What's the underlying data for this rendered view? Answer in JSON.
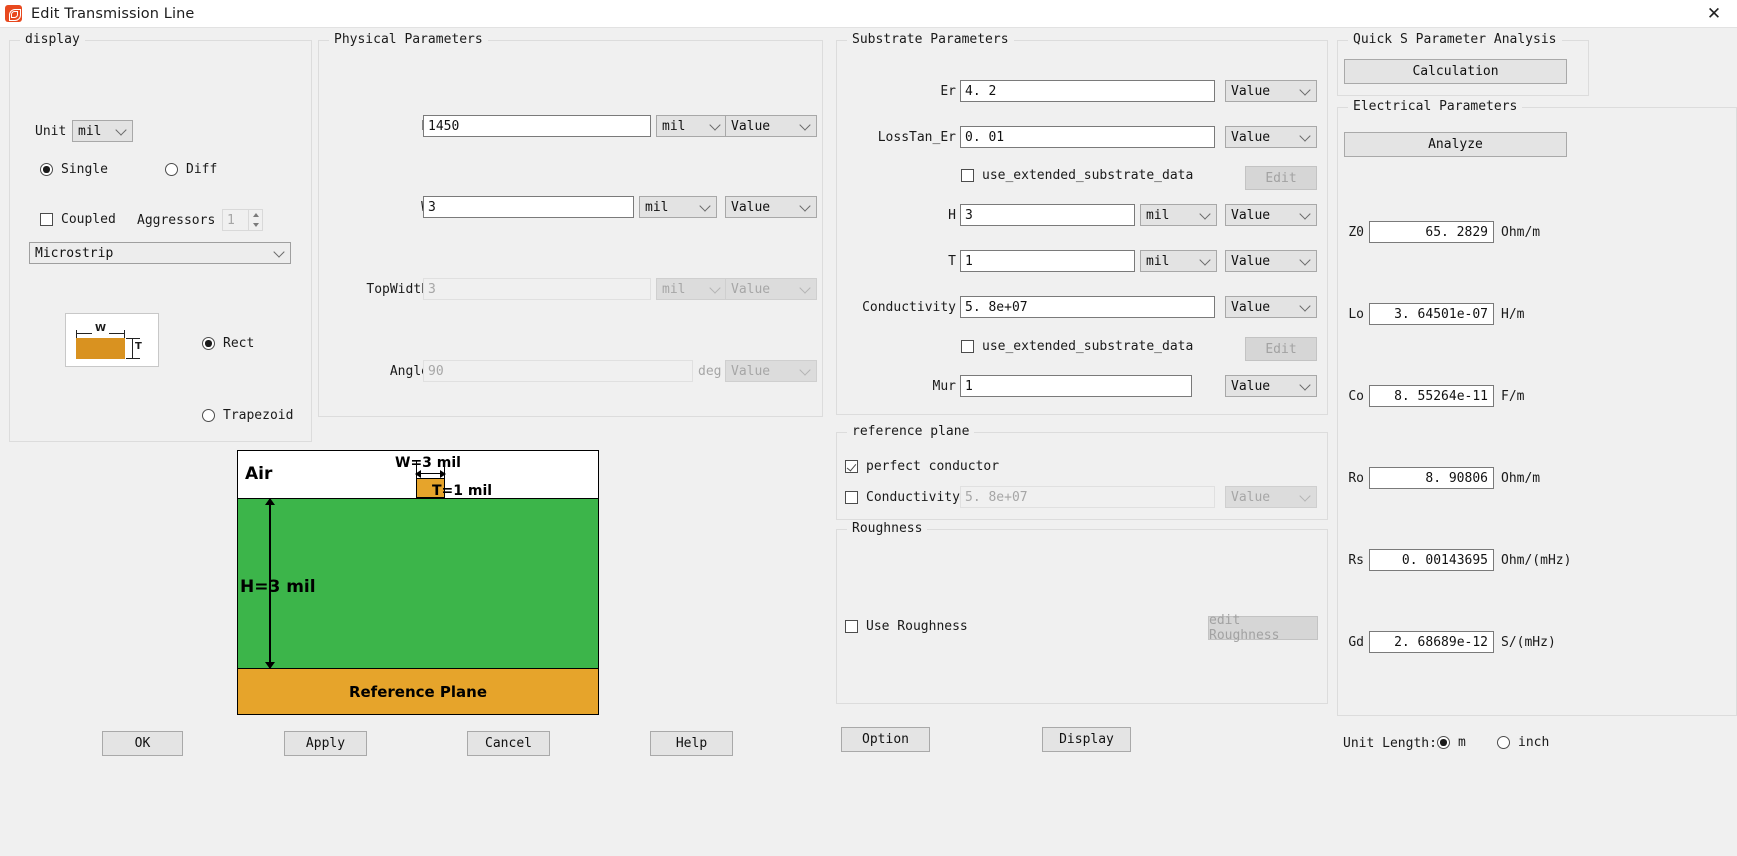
{
  "window": {
    "title": "Edit Transmission Line",
    "app_icon": "app-logo-icon",
    "close_icon": "✕"
  },
  "display_group": {
    "legend": "display",
    "unit_label": "Unit",
    "unit_value": "mil",
    "single_label": "Single",
    "diff_label": "Diff",
    "coupled_label": "Coupled",
    "aggressors_label": "Aggressors",
    "aggressors_value": "1",
    "line_type": "Microstrip",
    "rect_label": "Rect",
    "trapezoid_label": "Trapezoid",
    "preview_w": "W",
    "preview_t": "T"
  },
  "physical": {
    "legend": "Physical Parameters",
    "rows": [
      {
        "label": "L",
        "value": "1450",
        "unit": "mil",
        "mode": "Value",
        "suffix": ""
      },
      {
        "label": "W",
        "value": "3",
        "unit": "mil",
        "mode": "Value",
        "suffix": ""
      },
      {
        "label": "TopWidth",
        "value": "3",
        "unit": "mil",
        "mode": "Value",
        "suffix": ""
      },
      {
        "label": "Angle",
        "value": "90",
        "unit": "",
        "mode": "Value",
        "suffix": "deg"
      }
    ]
  },
  "substrate": {
    "legend": "Substrate Parameters",
    "er_label": "Er",
    "er_value": "4. 2",
    "er_mode": "Value",
    "losstan_label": "LossTan_Er",
    "losstan_value": "0. 01",
    "losstan_mode": "Value",
    "ext_data_1_label": "use_extended_substrate_data",
    "edit_1_label": "Edit",
    "h_label": "H",
    "h_value": "3",
    "h_unit": "mil",
    "h_mode": "Value",
    "t_label": "T",
    "t_value": "1",
    "t_unit": "mil",
    "t_mode": "Value",
    "cond_label": "Conductivity",
    "cond_value": "5. 8e+07",
    "cond_mode": "Value",
    "ext_data_2_label": "use_extended_substrate_data",
    "edit_2_label": "Edit",
    "mur_label": "Mur",
    "mur_value": "1",
    "mur_mode": "Value"
  },
  "reference_plane": {
    "legend": "reference plane",
    "perfect_conductor_label": "perfect conductor",
    "conductivity_label": "Conductivity",
    "conductivity_value": "5. 8e+07",
    "conductivity_mode": "Value"
  },
  "roughness": {
    "legend": "Roughness",
    "use_roughness_label": "Use Roughness",
    "edit_roughness_label": "edit Roughness"
  },
  "quick_s": {
    "legend": "Quick S Parameter Analysis",
    "calculation_label": "Calculation"
  },
  "electrical": {
    "legend": "Electrical Parameters",
    "analyze_label": "Analyze",
    "rows": [
      {
        "label": "Z0",
        "value": "65. 2829",
        "unit": "Ohm/m"
      },
      {
        "label": "Lo",
        "value": "3. 64501e-07",
        "unit": "H/m"
      },
      {
        "label": "Co",
        "value": "8. 55264e-11",
        "unit": "F/m"
      },
      {
        "label": "Ro",
        "value": "8. 90806",
        "unit": "Ohm/m"
      },
      {
        "label": "Rs",
        "value": "0. 00143695",
        "unit": "Ohm/(mHz)"
      },
      {
        "label": "Gd",
        "value": "2. 68689e-12",
        "unit": "S/(mHz)"
      }
    ]
  },
  "footer": {
    "ok_label": "OK",
    "apply_label": "Apply",
    "cancel_label": "Cancel",
    "help_label": "Help",
    "option_label": "Option",
    "display_label": "Display",
    "unit_length_label": "Unit Length:",
    "unit_m_label": "m",
    "unit_inch_label": "inch"
  },
  "diagram": {
    "air_label": "Air",
    "w_label": "W=3 mil",
    "t_label": "T=1 mil",
    "h_label": "H=3 mil",
    "reference_plane_label": "Reference Plane",
    "colors": {
      "substrate": "#3cb54a",
      "conductor": "#e6a42b",
      "air": "#ffffff"
    }
  }
}
